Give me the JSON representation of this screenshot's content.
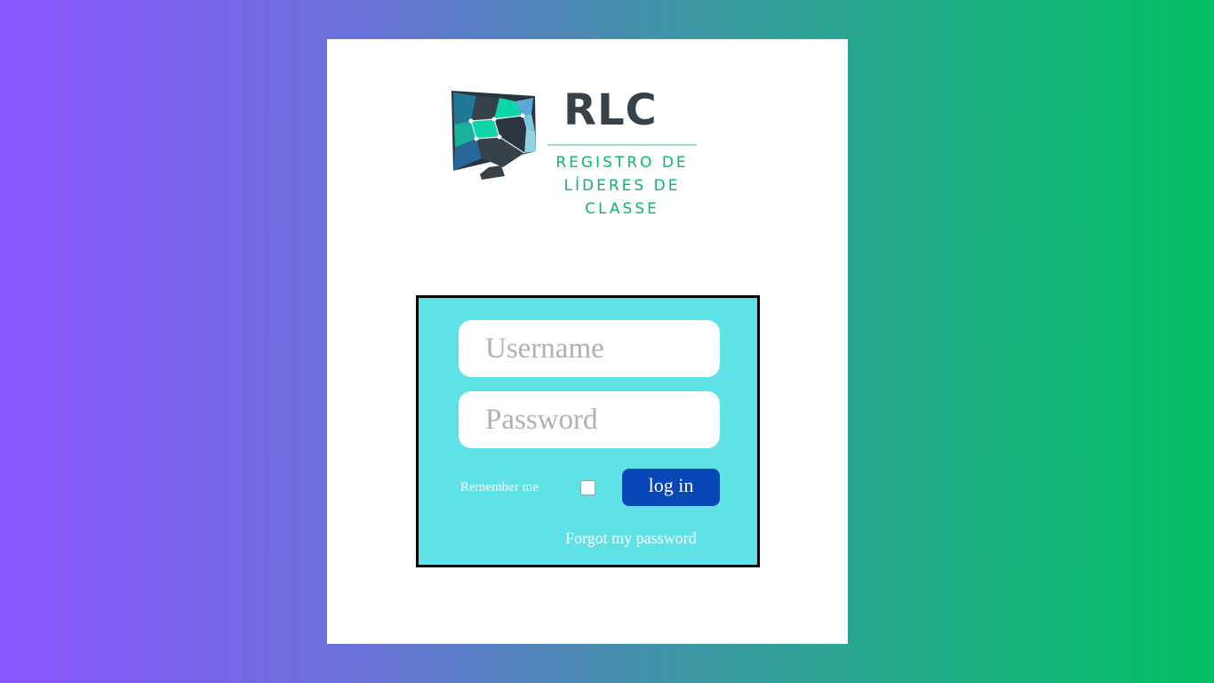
{
  "logo": {
    "title": "RLC",
    "subtitle_lines": [
      "REGISTRO DE",
      "LÍDERES DE",
      "CLASSE"
    ]
  },
  "login": {
    "username_placeholder": "Username",
    "password_placeholder": "Password",
    "remember_label": "Remember me",
    "remember_checked": false,
    "login_button_label": "log in",
    "forgot_link_label": "Forgot my password"
  },
  "colors": {
    "background_gradient": [
      "#8b55ff",
      "#02bf62"
    ],
    "login_box_bg": "#5ee2e6",
    "login_button_bg": "#0747b8",
    "logo_title": "#37414a",
    "logo_subtitle": "#12b36a"
  }
}
